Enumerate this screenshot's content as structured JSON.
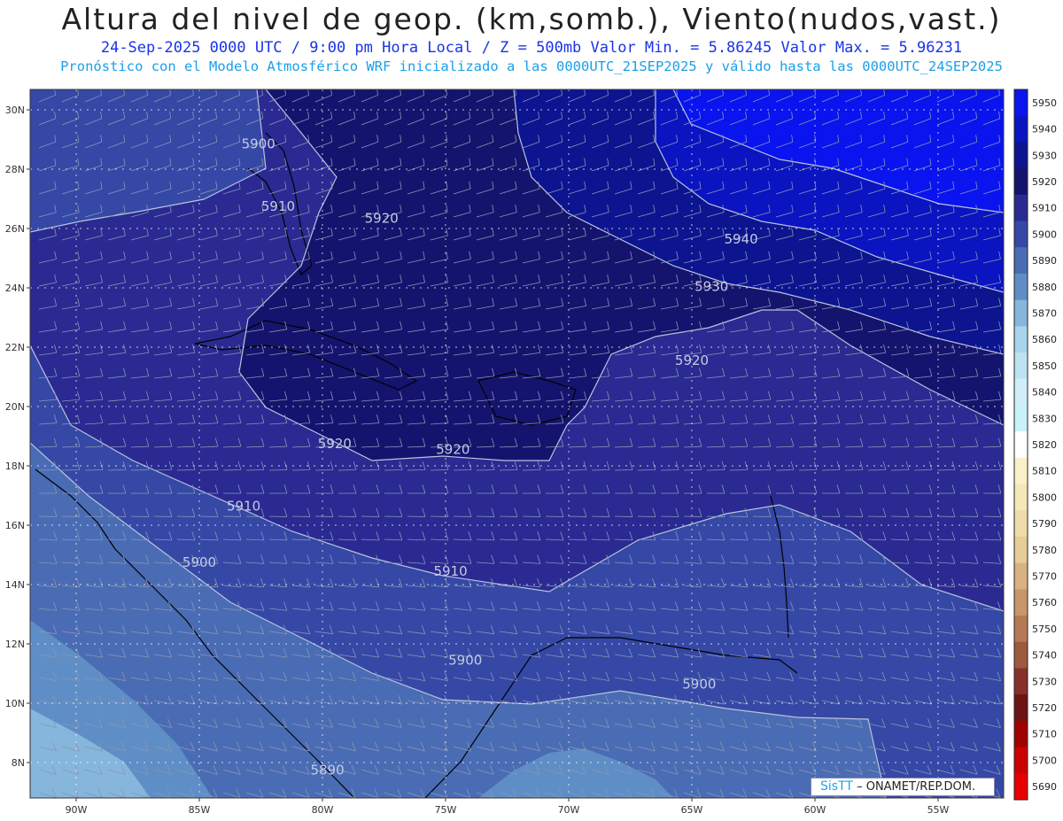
{
  "header": {
    "title": "Altura del nivel de geop. (km,somb.), Viento(nudos,vast.)",
    "subtitle": "24-Sep-2025  0000 UTC / 9:00 pm Hora Local / Z = 500mb     Valor Min. = 5.86245  Valor Max. = 5.96231",
    "model_line": "Pronóstico con el Modelo Atmosférico WRF inicializado a las 0000UTC_21SEP2025 y válido hasta las  0000UTC_24SEP2025"
  },
  "map": {
    "lat_ticks": [
      "30N",
      "28N",
      "26N",
      "24N",
      "22N",
      "20N",
      "18N",
      "16N",
      "14N",
      "12N",
      "10N",
      "8N"
    ],
    "lon_ticks": [
      "90W",
      "85W",
      "80W",
      "75W",
      "70W",
      "65W",
      "60W",
      "55W"
    ],
    "lat_values": [
      30,
      28,
      26,
      24,
      22,
      20,
      18,
      16,
      14,
      12,
      10,
      8
    ],
    "lon_values": [
      -90,
      -85,
      -80,
      -75,
      -70,
      -65,
      -60,
      -55
    ],
    "contour_labels": [
      {
        "text": "5900",
        "lon": -82.6,
        "lat": 28.7
      },
      {
        "text": "5910",
        "lon": -81.8,
        "lat": 26.6
      },
      {
        "text": "5920",
        "lon": -77.6,
        "lat": 26.2
      },
      {
        "text": "5940",
        "lon": -63.0,
        "lat": 25.5
      },
      {
        "text": "5930",
        "lon": -64.2,
        "lat": 23.9
      },
      {
        "text": "5920",
        "lon": -65.0,
        "lat": 21.4
      },
      {
        "text": "5920",
        "lon": -79.5,
        "lat": 18.6
      },
      {
        "text": "5920",
        "lon": -74.7,
        "lat": 18.4
      },
      {
        "text": "5910",
        "lon": -83.2,
        "lat": 16.5
      },
      {
        "text": "5900",
        "lon": -85.0,
        "lat": 14.6
      },
      {
        "text": "5910",
        "lon": -74.8,
        "lat": 14.3
      },
      {
        "text": "5900",
        "lon": -74.2,
        "lat": 11.3
      },
      {
        "text": "5900",
        "lon": -64.7,
        "lat": 10.5
      },
      {
        "text": "5890",
        "lon": -79.8,
        "lat": 7.6
      }
    ]
  },
  "colorbar": {
    "levels": [
      "5950",
      "5940",
      "5930",
      "5920",
      "5910",
      "5900",
      "5890",
      "5880",
      "5870",
      "5860",
      "5850",
      "5840",
      "5830",
      "5820",
      "5810",
      "5800",
      "5790",
      "5780",
      "5770",
      "5760",
      "5750",
      "5740",
      "5730",
      "5720",
      "5710",
      "5700",
      "5690"
    ],
    "colors": [
      "#0a14ee",
      "#0a14c0",
      "#0c1490",
      "#14146e",
      "#2a2a92",
      "#3548a6",
      "#4a6cb4",
      "#5f8ec6",
      "#86b6dc",
      "#a8d4ec",
      "#bde3f3",
      "#d0edf8",
      "#c8f2f8",
      "#ffffff",
      "#faf1c8",
      "#f5e8b8",
      "#efdcaa",
      "#e6cc96",
      "#d8b282",
      "#c8966a",
      "#b57a55",
      "#9d5a3e",
      "#85302b",
      "#6e1414",
      "#a00000",
      "#cc0000",
      "#e80000"
    ]
  },
  "credit": {
    "brand": "SisTT",
    "org": "– ONAMET/REP.DOM."
  }
}
